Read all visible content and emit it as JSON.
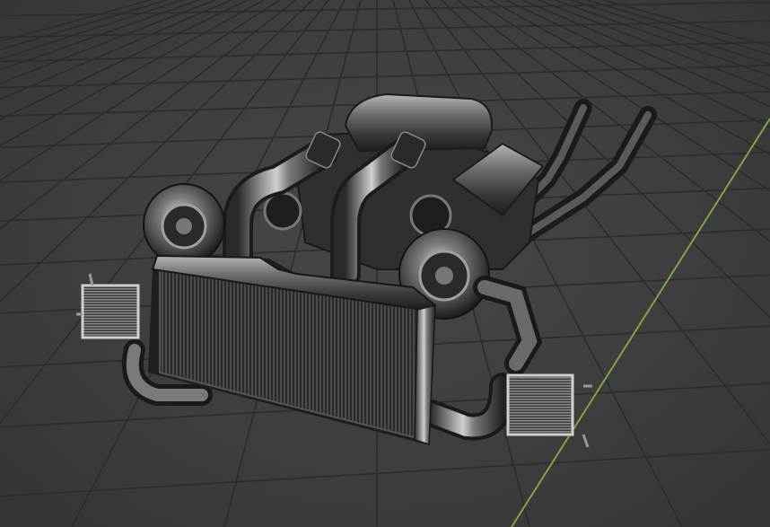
{
  "viewport": {
    "kind": "3d-viewport",
    "background_color": "#3d3d3d",
    "grid_color": "#2c2c2c",
    "y_axis_color": "#7da73f",
    "grid_visible": true
  },
  "model": {
    "name": "",
    "shading": "solid",
    "material_color": "#8c8c8c"
  }
}
